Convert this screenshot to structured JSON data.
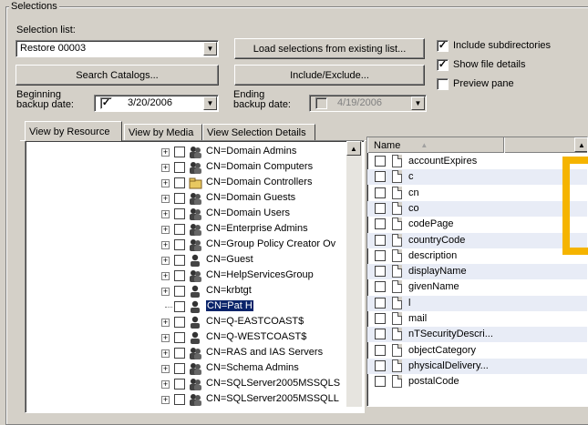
{
  "group": {
    "title": "Selections"
  },
  "selection_list": {
    "label": "Selection list:",
    "value": "Restore 00003"
  },
  "buttons": {
    "load_selections": "Load selections from existing list...",
    "search_catalogs": "Search Catalogs...",
    "include_exclude": "Include/Exclude..."
  },
  "options": {
    "include_subdirectories": {
      "label": "Include subdirectories",
      "checked": true
    },
    "show_file_details": {
      "label": "Show file details",
      "checked": true
    },
    "preview_pane": {
      "label": "Preview pane",
      "checked": false
    }
  },
  "beginning_backup": {
    "label_line1": "Beginning",
    "label_line2": "backup date:",
    "checked": true,
    "value": "3/20/2006"
  },
  "ending_backup": {
    "label_line1": "Ending",
    "label_line2": "backup date:",
    "checked": false,
    "value": "4/19/2006"
  },
  "tabs": [
    {
      "label": "View by Resource",
      "active": true
    },
    {
      "label": "View by Media",
      "active": false
    },
    {
      "label": "View Selection Details",
      "active": false
    }
  ],
  "tree_items": [
    {
      "label": "CN=Domain Admins",
      "expandable": true,
      "icon": "user-group-icon"
    },
    {
      "label": "CN=Domain Computers",
      "expandable": true,
      "icon": "user-group-icon"
    },
    {
      "label": "CN=Domain Controllers",
      "expandable": true,
      "icon": "folder-icon"
    },
    {
      "label": "CN=Domain Guests",
      "expandable": true,
      "icon": "user-group-icon"
    },
    {
      "label": "CN=Domain Users",
      "expandable": true,
      "icon": "user-group-icon"
    },
    {
      "label": "CN=Enterprise Admins",
      "expandable": true,
      "icon": "user-group-icon"
    },
    {
      "label": "CN=Group Policy Creator Ov",
      "expandable": true,
      "icon": "user-group-icon"
    },
    {
      "label": "CN=Guest",
      "expandable": true,
      "icon": "user-icon"
    },
    {
      "label": "CN=HelpServicesGroup",
      "expandable": true,
      "icon": "user-group-icon"
    },
    {
      "label": "CN=krbtgt",
      "expandable": true,
      "icon": "user-icon"
    },
    {
      "label": "CN=Pat H",
      "expandable": false,
      "icon": "user-icon",
      "selected": true
    },
    {
      "label": "CN=Q-EASTCOAST$",
      "expandable": true,
      "icon": "user-icon"
    },
    {
      "label": "CN=Q-WESTCOAST$",
      "expandable": true,
      "icon": "user-icon"
    },
    {
      "label": "CN=RAS and IAS Servers",
      "expandable": true,
      "icon": "user-group-icon"
    },
    {
      "label": "CN=Schema Admins",
      "expandable": true,
      "icon": "user-group-icon"
    },
    {
      "label": "CN=SQLServer2005MSSQLS",
      "expandable": true,
      "icon": "user-group-icon"
    },
    {
      "label": "CN=SQLServer2005MSSQLL",
      "expandable": true,
      "icon": "user-group-icon"
    }
  ],
  "list_header": {
    "name_col": "Name"
  },
  "list_items": [
    "accountExpires",
    "c",
    "cn",
    "co",
    "codePage",
    "countryCode",
    "description",
    "displayName",
    "givenName",
    "l",
    "mail",
    "nTSecurityDescri...",
    "objectCategory",
    "physicalDelivery...",
    "postalCode"
  ],
  "colors": {
    "selection": "#0a246a",
    "highlight_mark": "#f5b400"
  }
}
